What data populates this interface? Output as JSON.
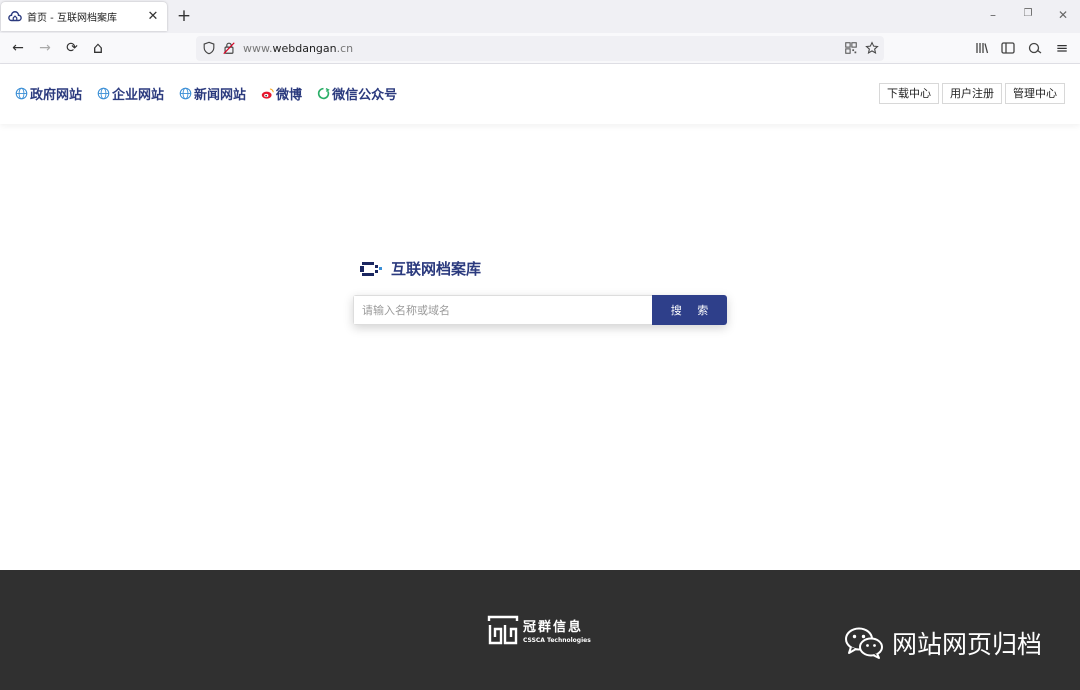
{
  "browser": {
    "tab_title": "首页 - 互联网档案库",
    "tab_close": "✕",
    "new_tab": "+",
    "url_host": "www.",
    "url_domain": "webdangan",
    "url_tld": ".cn",
    "window_minimize": "–",
    "window_restore": "❐",
    "window_close": "✕",
    "back": "←",
    "forward": "→",
    "reload": "⟳",
    "home": "⌂",
    "menu": "≡"
  },
  "header": {
    "nav": [
      {
        "label": "政府网站",
        "icon": "globe-icon"
      },
      {
        "label": "企业网站",
        "icon": "globe-icon"
      },
      {
        "label": "新闻网站",
        "icon": "globe-icon"
      },
      {
        "label": "微博",
        "icon": "weibo-icon"
      },
      {
        "label": "微信公众号",
        "icon": "wechat-icon"
      }
    ],
    "buttons": {
      "download": "下载中心",
      "register": "用户注册",
      "admin": "管理中心"
    }
  },
  "main": {
    "site_title": "互联网档案库",
    "search_placeholder": "请输入名称或域名",
    "search_button": "搜 索"
  },
  "footer": {
    "company_name": "冠群信息",
    "company_en": "CSSCA Technologies",
    "watermark": "网站网页归档"
  },
  "colors": {
    "brand": "#2e3f8a",
    "footer_bg": "#303030",
    "weibo": "#e6162d",
    "wechat": "#2aae67"
  }
}
